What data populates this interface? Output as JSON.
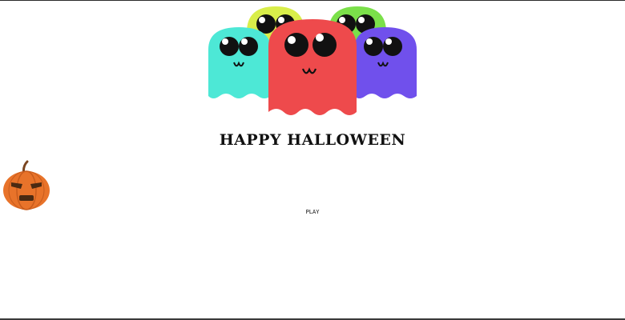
{
  "title": "HAPPY HALLOWEEN",
  "play_label": "PLAY",
  "ghosts": [
    {
      "name": "yellow",
      "color": "#d9ee4a"
    },
    {
      "name": "green",
      "color": "#7be04a"
    },
    {
      "name": "cyan",
      "color": "#4de8d6"
    },
    {
      "name": "purple",
      "color": "#7050ec"
    },
    {
      "name": "red",
      "color": "#ee4a4c"
    }
  ],
  "pumpkin_color": "#e8732a",
  "icons": [
    "ghost-icon",
    "pumpkin-icon"
  ]
}
